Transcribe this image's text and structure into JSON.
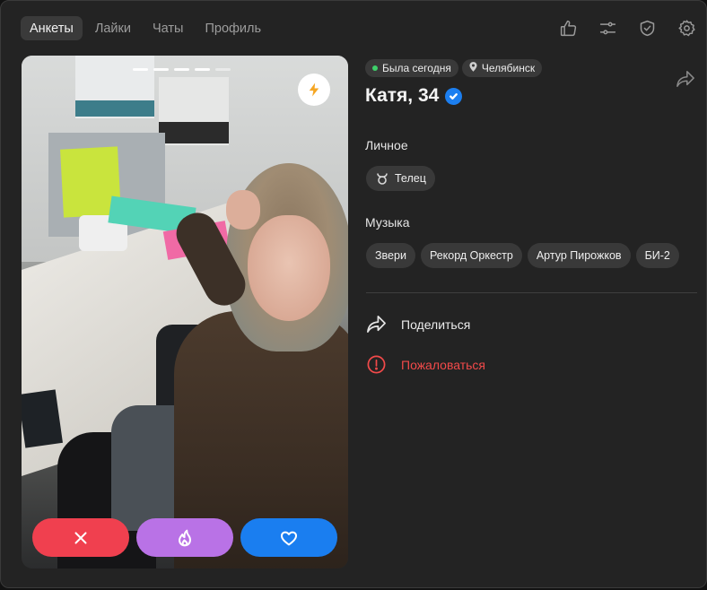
{
  "nav": {
    "tabs": [
      {
        "label": "Анкеты",
        "active": true
      },
      {
        "label": "Лайки",
        "active": false
      },
      {
        "label": "Чаты",
        "active": false
      },
      {
        "label": "Профиль",
        "active": false
      }
    ]
  },
  "top_icons": [
    "thumbs-up-icon",
    "filters-icon",
    "shield-check-icon",
    "settings-gear-icon"
  ],
  "profile": {
    "status": "Была сегодня",
    "city": "Челябинск",
    "name_age": "Катя, 34",
    "verified": true
  },
  "photo": {
    "story_total": 5,
    "story_active": 4
  },
  "sections": {
    "personal": {
      "title": "Личное",
      "chips": [
        {
          "label": "Телец",
          "icon": "taurus-icon"
        }
      ]
    },
    "music": {
      "title": "Музыка",
      "chips": [
        {
          "label": "Звери"
        },
        {
          "label": "Рекорд Оркестр"
        },
        {
          "label": "Артур Пирожков"
        },
        {
          "label": "БИ-2"
        }
      ]
    }
  },
  "links": {
    "share": "Поделиться",
    "report": "Пожаловаться"
  },
  "colors": {
    "dislike": "#f0404f",
    "superlike": "#b972e6",
    "like": "#1a7ef0",
    "report": "#f24a4a",
    "online": "#3ed06a",
    "verified": "#1c7ff0"
  }
}
